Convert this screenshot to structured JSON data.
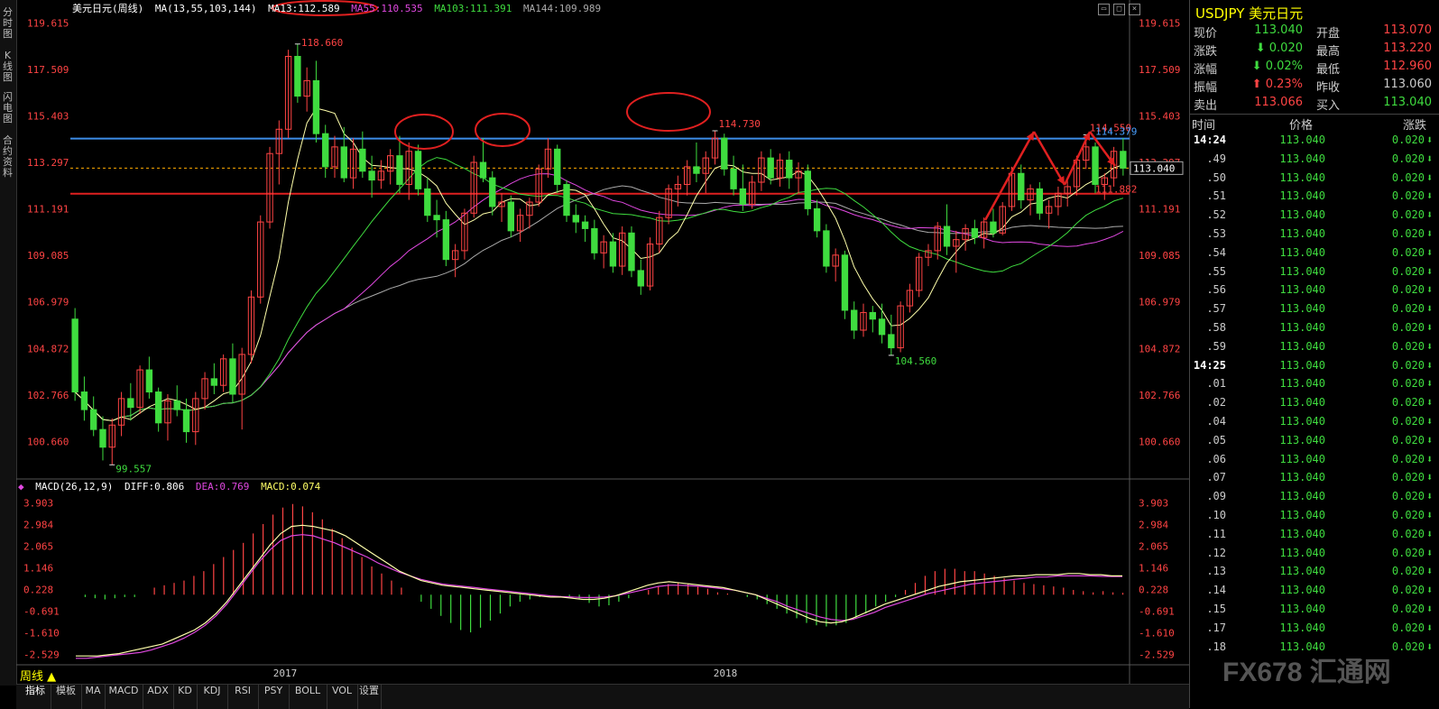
{
  "chart_title": {
    "symbol_name": "美元日元",
    "period_label": "(周线)"
  },
  "ma_legend": [
    {
      "label": "MA(13,55,103,144)",
      "color": "#ffffff"
    },
    {
      "label": "MA13:112.589",
      "color": "#ffffff"
    },
    {
      "label": "MA55:110.535",
      "color": "#e048e0"
    },
    {
      "label": "MA103:111.391",
      "color": "#3fdc3f"
    },
    {
      "label": "MA144:109.989",
      "color": "#aaaaaa"
    }
  ],
  "macd_legend": [
    {
      "label": "MACD(26,12,9)",
      "color": "#ffffff"
    },
    {
      "label": "DIFF:0.806",
      "color": "#ffffff"
    },
    {
      "label": "DEA:0.769",
      "color": "#e048e0"
    },
    {
      "label": "MACD:0.074",
      "color": "#ffff66"
    }
  ],
  "left_tabs": [
    {
      "label": "分时图"
    },
    {
      "label": "K线图"
    },
    {
      "label": "闪电图"
    },
    {
      "label": "合约资料"
    }
  ],
  "price_axis": [
    "119.615",
    "117.509",
    "115.403",
    "113.297",
    "111.191",
    "109.085",
    "106.979",
    "104.872",
    "102.766",
    "100.660"
  ],
  "macd_axis": [
    "3.903",
    "2.984",
    "2.065",
    "1.146",
    "0.228",
    "-0.691",
    "-1.610",
    "-2.529"
  ],
  "x_labels": [
    "2017",
    "2018"
  ],
  "annotations": {
    "high_2016": "118.660",
    "low_2016": "99.557",
    "high_2017": "114.730",
    "low_2018": "104.560",
    "high_2018": "114.550",
    "line_blue": "114.379",
    "line_red": "111.882",
    "current_price": "113.040"
  },
  "period_button": "周线 ▲",
  "bottom_tabs": [
    "指标",
    "模板",
    "MA",
    "MACD",
    "ADX",
    "KD",
    "KDJ",
    "RSI",
    "PSY",
    "BOLL",
    "VOL",
    "设置"
  ],
  "quote": {
    "symbol": "USDJPY",
    "name": "美元日元",
    "rows": [
      {
        "k1": "现价",
        "v1": "113.040",
        "c1": "#3fdc3f",
        "k2": "开盘",
        "v2": "113.070",
        "c2": "#ff4444"
      },
      {
        "k1": "涨跌",
        "v1": "⬇ 0.020",
        "c1": "#3fdc3f",
        "k2": "最高",
        "v2": "113.220",
        "c2": "#ff4444"
      },
      {
        "k1": "涨幅",
        "v1": "⬇ 0.02%",
        "c1": "#3fdc3f",
        "k2": "最低",
        "v2": "112.960",
        "c2": "#ff4444"
      },
      {
        "k1": "振幅",
        "v1": "⬆ 0.23%",
        "c1": "#ff4444",
        "k2": "昨收",
        "v2": "113.060",
        "c2": "#cccccc"
      },
      {
        "k1": "卖出",
        "v1": "113.066",
        "c1": "#ff4444",
        "k2": "买入",
        "v2": "113.040",
        "c2": "#3fdc3f"
      }
    ]
  },
  "ticks_header": {
    "time": "时间",
    "price": "价格",
    "change": "涨跌"
  },
  "ticks": [
    {
      "t": "14:24",
      "p": "113.040",
      "c": "0.020"
    },
    {
      "t": ".49",
      "p": "113.040",
      "c": "0.020"
    },
    {
      "t": ".50",
      "p": "113.040",
      "c": "0.020"
    },
    {
      "t": ".51",
      "p": "113.040",
      "c": "0.020"
    },
    {
      "t": ".52",
      "p": "113.040",
      "c": "0.020"
    },
    {
      "t": ".53",
      "p": "113.040",
      "c": "0.020"
    },
    {
      "t": ".54",
      "p": "113.040",
      "c": "0.020"
    },
    {
      "t": ".55",
      "p": "113.040",
      "c": "0.020"
    },
    {
      "t": ".56",
      "p": "113.040",
      "c": "0.020"
    },
    {
      "t": ".57",
      "p": "113.040",
      "c": "0.020"
    },
    {
      "t": ".58",
      "p": "113.040",
      "c": "0.020"
    },
    {
      "t": ".59",
      "p": "113.040",
      "c": "0.020"
    },
    {
      "t": "14:25",
      "p": "113.040",
      "c": "0.020"
    },
    {
      "t": ".01",
      "p": "113.040",
      "c": "0.020"
    },
    {
      "t": ".02",
      "p": "113.040",
      "c": "0.020"
    },
    {
      "t": ".04",
      "p": "113.040",
      "c": "0.020"
    },
    {
      "t": ".05",
      "p": "113.040",
      "c": "0.020"
    },
    {
      "t": ".06",
      "p": "113.040",
      "c": "0.020"
    },
    {
      "t": ".07",
      "p": "113.040",
      "c": "0.020"
    },
    {
      "t": ".09",
      "p": "113.040",
      "c": "0.020"
    },
    {
      "t": ".10",
      "p": "113.040",
      "c": "0.020"
    },
    {
      "t": ".11",
      "p": "113.040",
      "c": "0.020"
    },
    {
      "t": ".12",
      "p": "113.040",
      "c": "0.020"
    },
    {
      "t": ".13",
      "p": "113.040",
      "c": "0.020"
    },
    {
      "t": ".14",
      "p": "113.040",
      "c": "0.020"
    },
    {
      "t": ".15",
      "p": "113.040",
      "c": "0.020"
    },
    {
      "t": ".17",
      "p": "113.040",
      "c": "0.020"
    },
    {
      "t": ".18",
      "p": "113.040",
      "c": "0.020"
    }
  ],
  "watermark": "FX678 汇通网",
  "colors": {
    "up": "#ff4444",
    "down": "#3fdc3f",
    "ma13": "#ffffaa",
    "ma55": "#e048e0",
    "ma103": "#3fdc3f",
    "ma144": "#aaaaaa",
    "blue_line": "#3d8de8",
    "red_line": "#e02020"
  },
  "chart_data": {
    "type": "candlestick",
    "ylim": [
      99.0,
      120.0
    ],
    "macd_ylim": [
      -2.9,
      4.3
    ],
    "candles": [
      [
        106.2,
        106.7,
        102.5,
        102.9
      ],
      [
        102.9,
        103.6,
        101.6,
        102.1
      ],
      [
        102.1,
        102.7,
        100.9,
        101.2
      ],
      [
        101.2,
        101.8,
        99.8,
        100.4
      ],
      [
        100.4,
        101.7,
        99.6,
        101.4
      ],
      [
        101.4,
        102.9,
        100.9,
        102.6
      ],
      [
        102.6,
        103.3,
        101.6,
        102.2
      ],
      [
        102.2,
        104.1,
        101.9,
        103.9
      ],
      [
        103.9,
        104.5,
        102.6,
        102.9
      ],
      [
        102.9,
        103.1,
        101.1,
        101.5
      ],
      [
        101.5,
        102.8,
        100.7,
        102.5
      ],
      [
        102.5,
        103.2,
        101.8,
        102.1
      ],
      [
        102.1,
        102.6,
        100.6,
        101.1
      ],
      [
        101.1,
        102.9,
        100.5,
        102.6
      ],
      [
        102.6,
        103.8,
        102.1,
        103.5
      ],
      [
        103.5,
        104.2,
        102.8,
        103.2
      ],
      [
        103.2,
        104.6,
        102.9,
        104.4
      ],
      [
        104.4,
        105.1,
        102.4,
        102.8
      ],
      [
        102.8,
        104.9,
        101.2,
        104.6
      ],
      [
        104.6,
        107.5,
        104.2,
        107.2
      ],
      [
        107.2,
        110.9,
        106.9,
        110.6
      ],
      [
        110.6,
        114.0,
        110.3,
        113.7
      ],
      [
        113.7,
        115.2,
        112.3,
        114.8
      ],
      [
        114.8,
        118.4,
        114.4,
        118.1
      ],
      [
        118.1,
        118.66,
        116.0,
        116.3
      ],
      [
        116.3,
        117.6,
        115.6,
        117.0
      ],
      [
        117.0,
        117.9,
        114.2,
        114.6
      ],
      [
        114.6,
        115.0,
        112.6,
        113.1
      ],
      [
        113.1,
        114.5,
        112.6,
        114.0
      ],
      [
        114.0,
        114.9,
        112.4,
        112.6
      ],
      [
        112.6,
        114.4,
        112.1,
        113.9
      ],
      [
        113.9,
        114.7,
        112.6,
        112.9
      ],
      [
        112.9,
        113.6,
        111.7,
        112.5
      ],
      [
        112.5,
        113.4,
        112.1,
        112.9
      ],
      [
        112.9,
        113.9,
        112.3,
        113.6
      ],
      [
        113.6,
        114.5,
        111.9,
        112.3
      ],
      [
        112.3,
        114.2,
        111.6,
        113.8
      ],
      [
        113.8,
        114.1,
        111.8,
        112.1
      ],
      [
        112.1,
        112.6,
        110.6,
        110.9
      ],
      [
        110.9,
        111.6,
        109.9,
        110.7
      ],
      [
        110.7,
        111.1,
        108.6,
        108.9
      ],
      [
        108.9,
        109.6,
        108.1,
        109.3
      ],
      [
        109.3,
        111.2,
        108.9,
        111.0
      ],
      [
        111.0,
        113.6,
        110.8,
        113.3
      ],
      [
        113.3,
        114.4,
        112.4,
        112.6
      ],
      [
        112.6,
        112.9,
        110.9,
        111.3
      ],
      [
        111.3,
        111.9,
        110.6,
        111.5
      ],
      [
        111.5,
        111.8,
        109.9,
        110.2
      ],
      [
        110.2,
        111.2,
        109.7,
        110.9
      ],
      [
        110.9,
        111.7,
        110.3,
        111.5
      ],
      [
        111.5,
        113.2,
        111.3,
        113.0
      ],
      [
        113.0,
        114.4,
        112.6,
        113.9
      ],
      [
        113.9,
        114.1,
        111.9,
        112.3
      ],
      [
        112.3,
        112.5,
        110.6,
        110.9
      ],
      [
        110.9,
        111.4,
        110.1,
        110.6
      ],
      [
        110.6,
        110.9,
        109.7,
        110.3
      ],
      [
        110.3,
        110.7,
        108.9,
        109.2
      ],
      [
        109.2,
        110.0,
        108.5,
        109.7
      ],
      [
        109.7,
        110.1,
        108.3,
        108.6
      ],
      [
        108.6,
        110.4,
        108.2,
        110.1
      ],
      [
        110.1,
        110.4,
        108.1,
        108.4
      ],
      [
        108.4,
        108.9,
        107.3,
        107.7
      ],
      [
        107.7,
        109.9,
        107.5,
        109.6
      ],
      [
        109.6,
        111.1,
        109.2,
        110.8
      ],
      [
        110.8,
        112.3,
        110.5,
        112.1
      ],
      [
        112.1,
        112.7,
        111.3,
        112.3
      ],
      [
        112.3,
        113.4,
        111.8,
        113.1
      ],
      [
        113.1,
        114.2,
        112.4,
        112.8
      ],
      [
        112.8,
        113.8,
        111.9,
        113.5
      ],
      [
        113.5,
        114.73,
        113.2,
        114.4
      ],
      [
        114.4,
        114.6,
        112.7,
        113.0
      ],
      [
        113.0,
        113.6,
        111.8,
        112.1
      ],
      [
        112.1,
        113.2,
        111.1,
        111.4
      ],
      [
        111.4,
        112.7,
        111.2,
        112.4
      ],
      [
        112.4,
        113.8,
        112.0,
        113.5
      ],
      [
        113.5,
        113.9,
        112.3,
        112.6
      ],
      [
        112.6,
        113.7,
        112.2,
        113.4
      ],
      [
        113.4,
        113.8,
        112.1,
        112.6
      ],
      [
        112.6,
        113.3,
        111.9,
        112.9
      ],
      [
        112.9,
        113.2,
        110.9,
        111.2
      ],
      [
        111.2,
        111.6,
        109.9,
        110.2
      ],
      [
        110.2,
        110.5,
        108.3,
        108.6
      ],
      [
        108.6,
        109.4,
        107.9,
        109.1
      ],
      [
        109.1,
        109.3,
        106.2,
        106.6
      ],
      [
        106.6,
        107.0,
        105.3,
        105.7
      ],
      [
        105.7,
        106.9,
        105.4,
        106.5
      ],
      [
        106.5,
        106.8,
        105.6,
        106.2
      ],
      [
        106.2,
        106.9,
        105.1,
        105.5
      ],
      [
        105.5,
        106.4,
        104.56,
        104.9
      ],
      [
        104.9,
        107.0,
        104.7,
        106.8
      ],
      [
        106.8,
        107.8,
        106.5,
        107.5
      ],
      [
        107.5,
        109.2,
        107.2,
        109.0
      ],
      [
        109.0,
        109.6,
        108.6,
        109.3
      ],
      [
        109.3,
        110.6,
        108.9,
        110.4
      ],
      [
        110.4,
        111.4,
        109.1,
        109.5
      ],
      [
        109.5,
        110.2,
        108.3,
        109.8
      ],
      [
        109.8,
        110.5,
        109.3,
        110.3
      ],
      [
        110.3,
        110.7,
        109.6,
        109.9
      ],
      [
        109.9,
        110.8,
        109.4,
        110.6
      ],
      [
        110.6,
        111.2,
        109.9,
        110.1
      ],
      [
        110.1,
        111.5,
        110.0,
        111.3
      ],
      [
        111.3,
        113.1,
        111.1,
        112.8
      ],
      [
        112.8,
        113.2,
        111.2,
        111.6
      ],
      [
        111.6,
        112.3,
        110.9,
        112.1
      ],
      [
        112.1,
        112.4,
        110.7,
        111.0
      ],
      [
        111.0,
        111.6,
        110.3,
        111.3
      ],
      [
        111.3,
        112.2,
        110.9,
        111.9
      ],
      [
        111.9,
        112.6,
        111.3,
        112.2
      ],
      [
        112.2,
        113.6,
        111.8,
        113.4
      ],
      [
        113.4,
        114.55,
        113.0,
        114.0
      ],
      [
        114.0,
        114.2,
        111.9,
        112.3
      ],
      [
        112.3,
        112.8,
        111.6,
        112.6
      ],
      [
        112.6,
        114.0,
        112.2,
        113.8
      ],
      [
        113.8,
        114.4,
        112.7,
        113.04
      ]
    ],
    "macd_hist": [
      0.0,
      -0.1,
      -0.15,
      -0.2,
      -0.15,
      -0.1,
      -0.1,
      0.0,
      0.3,
      0.4,
      0.5,
      0.6,
      0.8,
      1.0,
      1.3,
      1.6,
      1.9,
      2.2,
      2.6,
      3.0,
      3.4,
      3.7,
      3.85,
      3.75,
      3.5,
      3.2,
      2.8,
      2.4,
      2.0,
      1.6,
      1.2,
      0.9,
      0.6,
      0.3,
      0.0,
      -0.3,
      -0.6,
      -0.9,
      -1.2,
      -1.5,
      -1.6,
      -1.4,
      -1.1,
      -0.8,
      -0.5,
      -0.3,
      -0.2,
      -0.1,
      0.0,
      0.0,
      -0.1,
      -0.2,
      -0.35,
      -0.5,
      -0.45,
      -0.3,
      -0.15,
      0.0,
      0.2,
      0.35,
      0.45,
      0.5,
      0.45,
      0.35,
      0.25,
      0.1,
      0.05,
      0.0,
      -0.1,
      -0.2,
      -0.4,
      -0.6,
      -0.8,
      -1.0,
      -1.2,
      -1.3,
      -1.35,
      -1.3,
      -1.2,
      -1.0,
      -0.8,
      -0.5,
      -0.3,
      -0.1,
      0.2,
      0.5,
      0.8,
      1.0,
      1.1,
      1.1,
      1.0,
      1.0,
      0.9,
      0.8,
      0.7,
      0.6,
      0.5,
      0.45,
      0.4,
      0.35,
      0.3,
      0.2,
      0.15,
      0.1,
      0.15,
      0.1,
      0.08
    ],
    "diff": [
      -2.6,
      -2.6,
      -2.6,
      -2.55,
      -2.5,
      -2.4,
      -2.3,
      -2.2,
      -2.1,
      -1.9,
      -1.7,
      -1.5,
      -1.2,
      -0.8,
      -0.3,
      0.3,
      0.9,
      1.5,
      2.1,
      2.6,
      2.9,
      2.95,
      2.9,
      2.8,
      2.7,
      2.5,
      2.2,
      1.9,
      1.6,
      1.3,
      1.0,
      0.8,
      0.6,
      0.5,
      0.4,
      0.35,
      0.3,
      0.25,
      0.2,
      0.15,
      0.1,
      0.05,
      0.0,
      -0.05,
      -0.1,
      -0.1,
      -0.15,
      -0.2,
      -0.2,
      -0.15,
      -0.05,
      0.1,
      0.25,
      0.4,
      0.5,
      0.55,
      0.5,
      0.45,
      0.4,
      0.35,
      0.3,
      0.2,
      0.1,
      0.0,
      -0.2,
      -0.4,
      -0.6,
      -0.8,
      -1.0,
      -1.15,
      -1.2,
      -1.15,
      -1.0,
      -0.8,
      -0.6,
      -0.4,
      -0.25,
      -0.1,
      0.05,
      0.2,
      0.35,
      0.45,
      0.55,
      0.6,
      0.65,
      0.7,
      0.75,
      0.8,
      0.8,
      0.85,
      0.85,
      0.85,
      0.9,
      0.9,
      0.85,
      0.85,
      0.8,
      0.8
    ],
    "dea": [
      -2.7,
      -2.7,
      -2.65,
      -2.6,
      -2.55,
      -2.5,
      -2.45,
      -2.35,
      -2.2,
      -2.05,
      -1.85,
      -1.6,
      -1.3,
      -0.9,
      -0.4,
      0.2,
      0.8,
      1.4,
      1.9,
      2.3,
      2.5,
      2.55,
      2.5,
      2.35,
      2.2,
      2.0,
      1.8,
      1.6,
      1.35,
      1.15,
      0.95,
      0.8,
      0.65,
      0.55,
      0.45,
      0.4,
      0.35,
      0.3,
      0.25,
      0.2,
      0.15,
      0.1,
      0.05,
      0.0,
      -0.05,
      -0.08,
      -0.1,
      -0.12,
      -0.12,
      -0.1,
      -0.05,
      0.05,
      0.15,
      0.25,
      0.35,
      0.4,
      0.4,
      0.38,
      0.35,
      0.3,
      0.25,
      0.2,
      0.1,
      0.0,
      -0.15,
      -0.3,
      -0.5,
      -0.65,
      -0.8,
      -0.95,
      -1.05,
      -1.1,
      -1.05,
      -0.9,
      -0.75,
      -0.55,
      -0.4,
      -0.25,
      -0.1,
      0.05,
      0.15,
      0.25,
      0.35,
      0.45,
      0.5,
      0.55,
      0.6,
      0.65,
      0.7,
      0.75,
      0.75,
      0.8,
      0.8,
      0.8,
      0.8,
      0.78,
      0.77,
      0.769
    ]
  }
}
